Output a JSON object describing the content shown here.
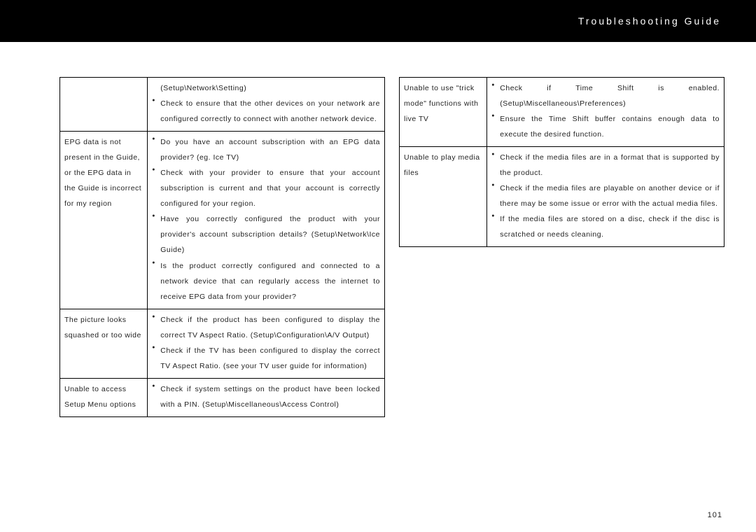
{
  "header": {
    "title": "Troubleshooting Guide"
  },
  "page_number": "101",
  "left_table": {
    "rows": [
      {
        "problem": "",
        "lines": [
          {
            "type": "path",
            "text": "(Setup\\Network\\Setting)"
          },
          {
            "type": "bullet",
            "text": "Check to ensure that the other devices on your network are configured correctly to connect with another network device."
          }
        ]
      },
      {
        "problem": "EPG data is not present in the Guide, or the EPG data in the Guide is incorrect for my region",
        "lines": [
          {
            "type": "bullet",
            "text": "Do you have an account subscription with an EPG data provider? (eg. Ice TV)"
          },
          {
            "type": "bullet",
            "text": "Check with your provider to ensure that your account subscription is current and that your account is correctly configured for your region."
          },
          {
            "type": "bullet",
            "text": "Have you correctly configured the product with your provider's account subscription details? (Setup\\Network\\Ice Guide)"
          },
          {
            "type": "bullet",
            "text": "Is the product correctly configured and connected to a network device that can regularly access the internet to receive EPG data from your provider?"
          }
        ]
      },
      {
        "problem": "The picture looks squashed or too wide",
        "lines": [
          {
            "type": "bullet",
            "text": "Check if the product has been configured to display the correct TV Aspect Ratio. (Setup\\Configuration\\A/V Output)"
          },
          {
            "type": "bullet",
            "text": "Check if the TV has been configured to display the correct TV Aspect Ratio. (see your TV user guide for information)"
          }
        ]
      },
      {
        "problem": "Unable to access Setup Menu options",
        "lines": [
          {
            "type": "bullet",
            "text": "Check if system settings on the product have been locked with a PIN. (Setup\\Miscellaneous\\Access Control)"
          }
        ]
      }
    ]
  },
  "right_table": {
    "rows": [
      {
        "problem": "Unable to use \"trick mode\" functions with live TV",
        "lines": [
          {
            "type": "bullet",
            "text": "Check if Time Shift is enabled. (Setup\\Miscellaneous\\Preferences)"
          },
          {
            "type": "bullet",
            "text": "Ensure the Time Shift buffer contains enough data to execute the desired function."
          }
        ]
      },
      {
        "problem": "Unable to play media files",
        "lines": [
          {
            "type": "bullet",
            "text": "Check if the media files are in a format that is supported by the product."
          },
          {
            "type": "bullet",
            "text": "Check if the media files are playable on another device or if there may be some issue or error with the actual media files."
          },
          {
            "type": "bullet",
            "text": "If the media files are stored on a disc, check if the disc is scratched or needs cleaning."
          }
        ]
      }
    ]
  }
}
